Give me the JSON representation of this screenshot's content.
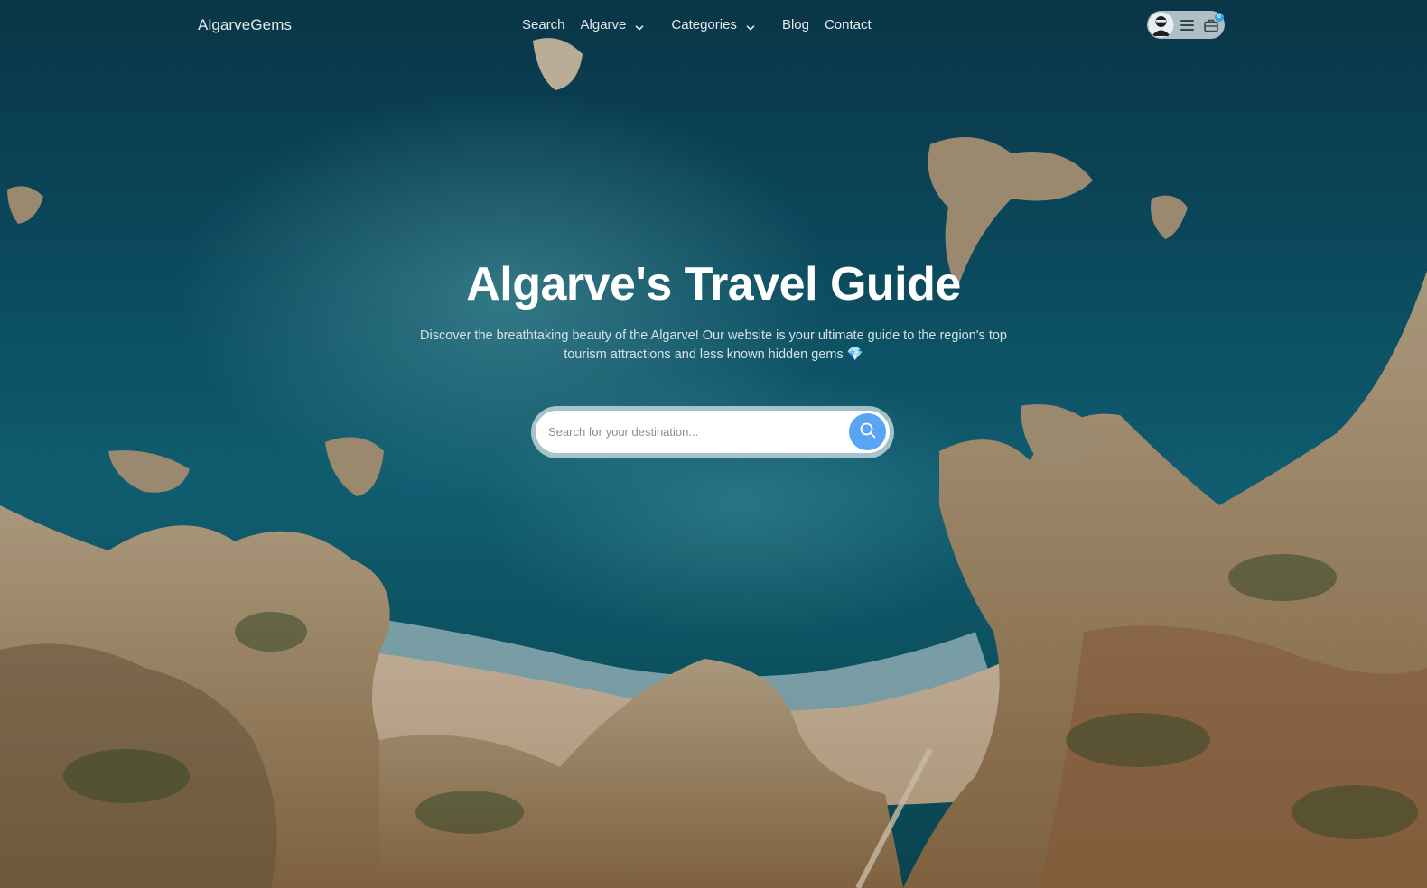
{
  "nav": {
    "brand": "AlgarveGems",
    "items": [
      {
        "label": "Search",
        "icon": null
      },
      {
        "label": "Algarve",
        "icon": "chevron-down-icon"
      },
      {
        "label": "Categories",
        "icon": "chevron-down-icon"
      },
      {
        "label": "Blog",
        "icon": null
      },
      {
        "label": "Contact",
        "icon": null
      }
    ],
    "user": {
      "avatar_icon": "user-avatar",
      "menu_icon": "hamburger-icon",
      "trip_icon": "suitcase-icon",
      "trip_count": "0"
    }
  },
  "hero": {
    "title": "Algarve's Travel Guide",
    "subtitle": "Discover the breathtaking beauty of the Algarve! Our website is your ultimate guide to the region's top tourism attractions and less known hidden gems",
    "subtitle_emoji": "💎",
    "search": {
      "placeholder": "Search for your destination...",
      "value": "",
      "button_icon": "search-icon"
    }
  },
  "colors": {
    "accent": "#5aa4f4",
    "nav_text": "#e3eaee",
    "badge": "#2aa3e0"
  }
}
